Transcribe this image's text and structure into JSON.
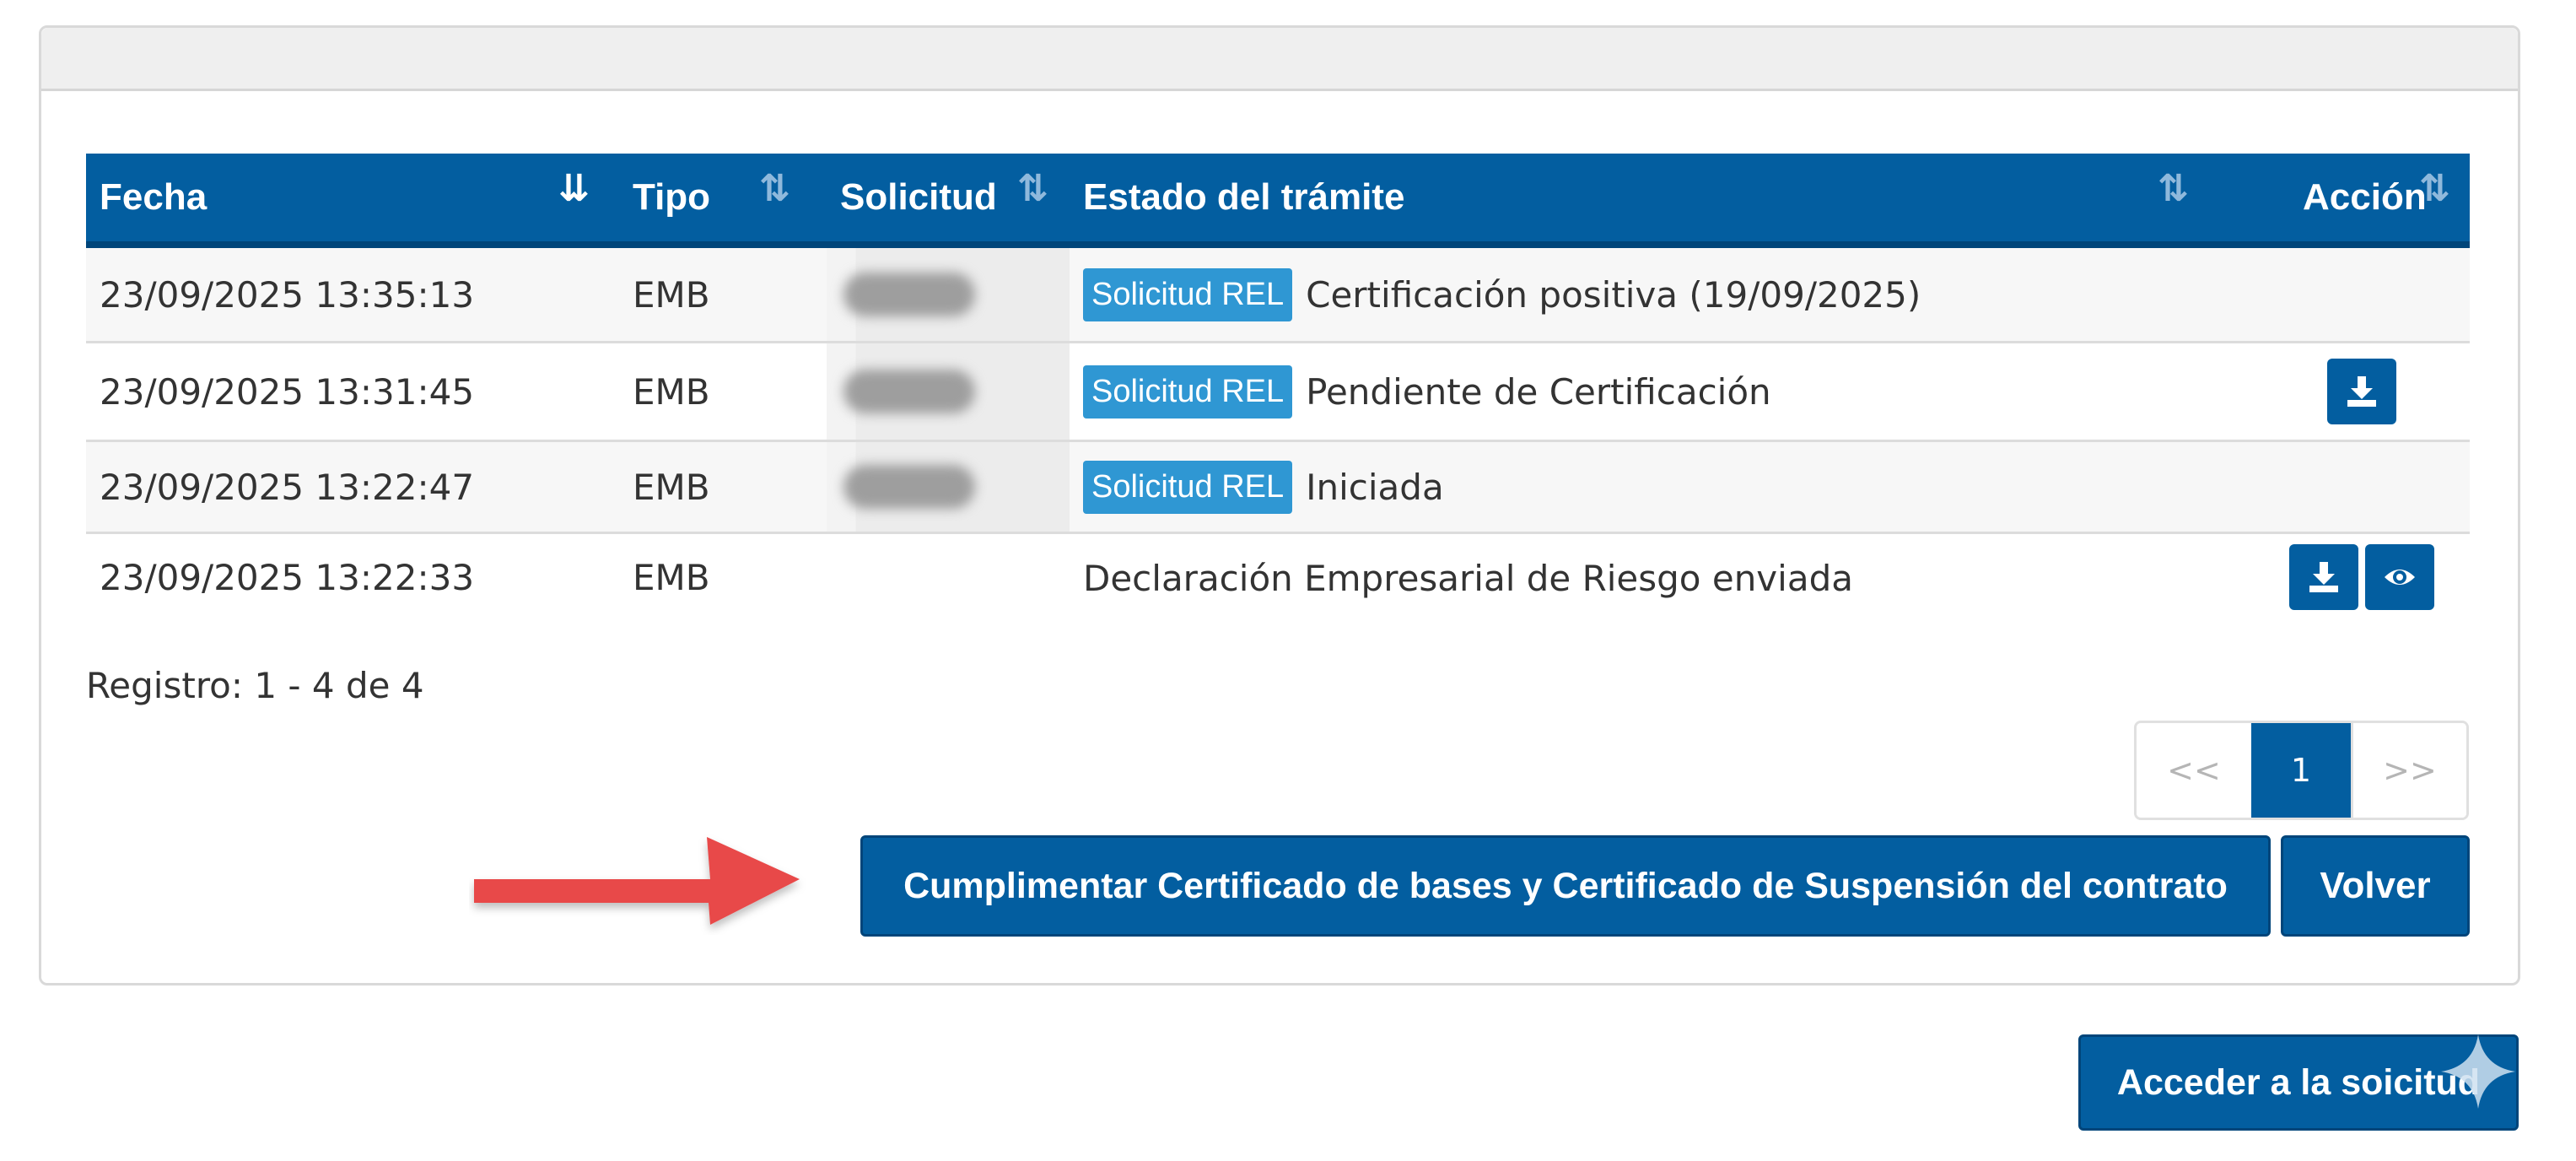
{
  "table": {
    "headers": {
      "fecha": "Fecha",
      "tipo": "Tipo",
      "solicitud": "Solicitud",
      "estado": "Estado del trámite",
      "accion": "Acción"
    },
    "sort_icon": "⇅",
    "rows": [
      {
        "fecha": "23/09/2025 13:35:13",
        "tipo": "EMB",
        "solicitud_redacted": true,
        "badge": "Solicitud REL",
        "estado": "Certificación positiva (19/09/2025)",
        "actions": []
      },
      {
        "fecha": "23/09/2025 13:31:45",
        "tipo": "EMB",
        "solicitud_redacted": true,
        "badge": "Solicitud REL",
        "estado": "Pendiente de Certificación",
        "actions": [
          "download-icon"
        ]
      },
      {
        "fecha": "23/09/2025 13:22:47",
        "tipo": "EMB",
        "solicitud_redacted": true,
        "badge": "Solicitud REL",
        "estado": "Iniciada",
        "actions": []
      },
      {
        "fecha": "23/09/2025 13:22:33",
        "tipo": "EMB",
        "solicitud_redacted": false,
        "badge": "",
        "estado": "Declaración Empresarial de Riesgo enviada",
        "actions": [
          "download-icon",
          "eye-icon"
        ]
      }
    ]
  },
  "registro": "Registro: 1 - 4 de 4",
  "pagination": {
    "prev": "<<",
    "current": "1",
    "next": ">>"
  },
  "buttons": {
    "cumplimentar": "Cumplimentar Certificado de bases y Certificado de Suspensión del contrato",
    "volver": "Volver",
    "acceder": "Acceder a la soicitud"
  },
  "colors": {
    "header_blue": "#035ea0",
    "badge_blue": "#2f97d3",
    "arrow_red": "#e84a4a"
  }
}
